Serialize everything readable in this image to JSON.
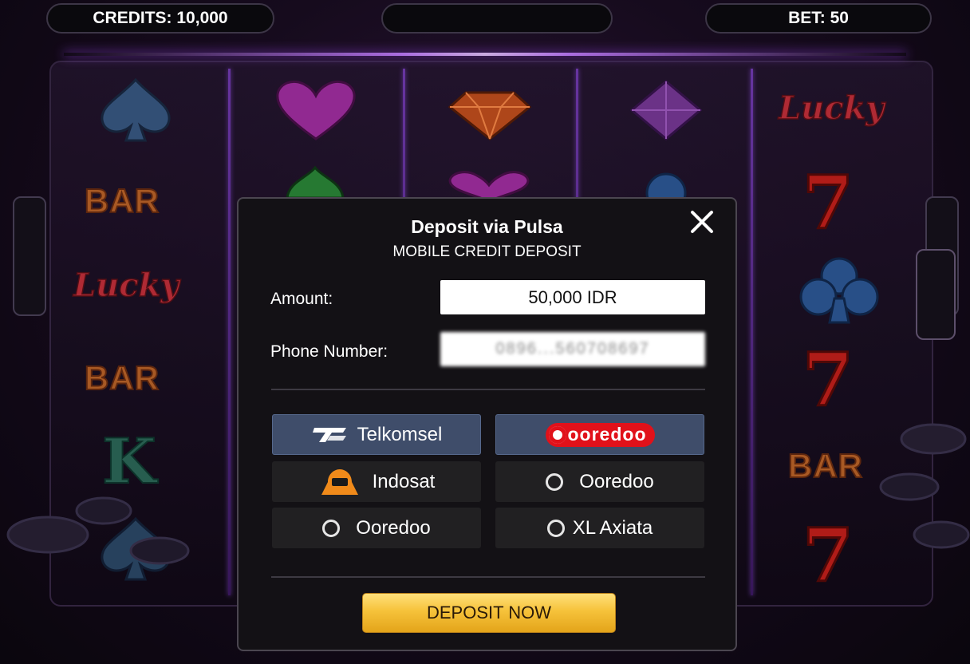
{
  "hud": {
    "credits": "CREDITS: 10,000",
    "center": "",
    "bet": "BET: 50"
  },
  "reels": {
    "symbol_labels": {
      "bar": "BAR",
      "lucky": "Lucky",
      "seven": "7",
      "king": "K"
    }
  },
  "modal": {
    "title": "Deposit via Pulsa",
    "subtitle": "MOBILE CREDIT DEPOSIT",
    "close_icon": "close-icon",
    "amount_label": "Amount:",
    "amount_value": "50,000 IDR",
    "phone_label": "Phone Number:",
    "phone_value": "0896...560708697",
    "providers": [
      {
        "label": "Telkomsel",
        "selected": true,
        "icon": "telkomsel-logo"
      },
      {
        "label": "ooredoo",
        "selected": true,
        "icon": "ooredoo-logo"
      },
      {
        "label": "Indosat",
        "selected": false,
        "icon": "indosat-logo"
      },
      {
        "label": "Ooredoo",
        "selected": false,
        "icon": "radio-icon"
      },
      {
        "label": "Ooredoo",
        "selected": false,
        "icon": "radio-icon"
      },
      {
        "label": "XL Axiata",
        "selected": false,
        "icon": "radio-icon"
      }
    ],
    "deposit_button": "DEPOSIT NOW"
  },
  "colors": {
    "accent_purple": "#a44cff",
    "modal_bg": "#131115",
    "selected_option": "#3f4d6a",
    "deposit_button": "#f6c23a",
    "ooredoo_red": "#e1111a"
  }
}
